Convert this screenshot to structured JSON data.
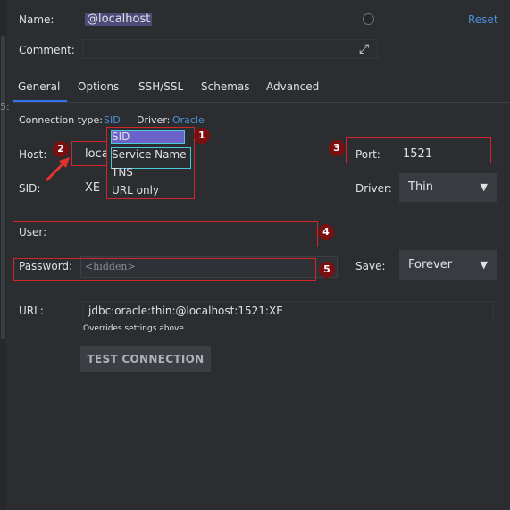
{
  "header": {
    "name_label": "Name:",
    "name_value": "@localhost",
    "reset_label": "Reset",
    "comment_label": "Comment:"
  },
  "tabs": [
    {
      "label": "General"
    },
    {
      "label": "Options"
    },
    {
      "label": "SSH/SSL"
    },
    {
      "label": "Schemas"
    },
    {
      "label": "Advanced"
    }
  ],
  "connection": {
    "type_label": "Connection type:",
    "type_value": "SID",
    "driver_label": "Driver:",
    "driver_value": "Oracle"
  },
  "form": {
    "host_label": "Host:",
    "host_value": "loca",
    "port_label": "Port:",
    "port_value": "1521",
    "sid_label": "SID:",
    "sid_value": "XE",
    "driver_label": "Driver:",
    "driver_select": "Thin",
    "user_label": "User:",
    "password_label": "Password:",
    "password_placeholder": "<hidden>",
    "save_label": "Save:",
    "save_select": "Forever",
    "url_label": "URL:",
    "url_value": "jdbc:oracle:thin:@localhost:1521:XE",
    "url_hint": "Overrides settings above",
    "test_button": "TEST CONNECTION"
  },
  "dropdown": {
    "items": [
      "SID",
      "Service Name",
      "TNS",
      "URL only"
    ]
  },
  "markers": [
    "1",
    "2",
    "3",
    "4",
    "5"
  ],
  "colors": {
    "accent": "#3574f0",
    "link": "#4c8fd6",
    "annotation_red": "#d4262a",
    "selection": "#6b63c9"
  }
}
